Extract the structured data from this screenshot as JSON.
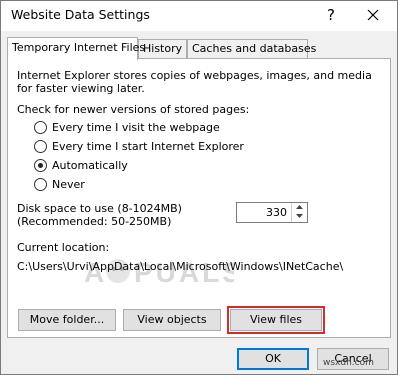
{
  "window": {
    "title": "Website Data Settings",
    "help_symbol": "?"
  },
  "tabs": [
    {
      "label": "Temporary Internet Files",
      "active": true
    },
    {
      "label": "History",
      "active": false
    },
    {
      "label": "Caches and databases",
      "active": false
    }
  ],
  "intro_text": {
    "line1": "Internet Explorer stores copies of webpages, images, and media",
    "line2": "for faster viewing later."
  },
  "check_label": "Check for newer versions of stored pages:",
  "radio_options": [
    {
      "label": "Every time I visit the webpage",
      "selected": false
    },
    {
      "label": "Every time I start Internet Explorer",
      "selected": false
    },
    {
      "label": "Automatically",
      "selected": true
    },
    {
      "label": "Never",
      "selected": false
    }
  ],
  "disk_space": {
    "label_line1": "Disk space to use (8-1024MB)",
    "label_line2": "(Recommended: 50-250MB)",
    "value": "330"
  },
  "location": {
    "label": "Current location:",
    "path": "C:\\Users\\Urvi\\AppData\\Local\\Microsoft\\Windows\\INetCache\\"
  },
  "watermark_logo": {
    "text": "APPUALS"
  },
  "buttons": {
    "move_folder": "Move folder...",
    "view_objects": "View objects",
    "view_files": "View files",
    "ok": "OK",
    "cancel": "Cancel"
  },
  "highlight_color": "#d62b2b",
  "site_watermark": "wsxdn.com"
}
